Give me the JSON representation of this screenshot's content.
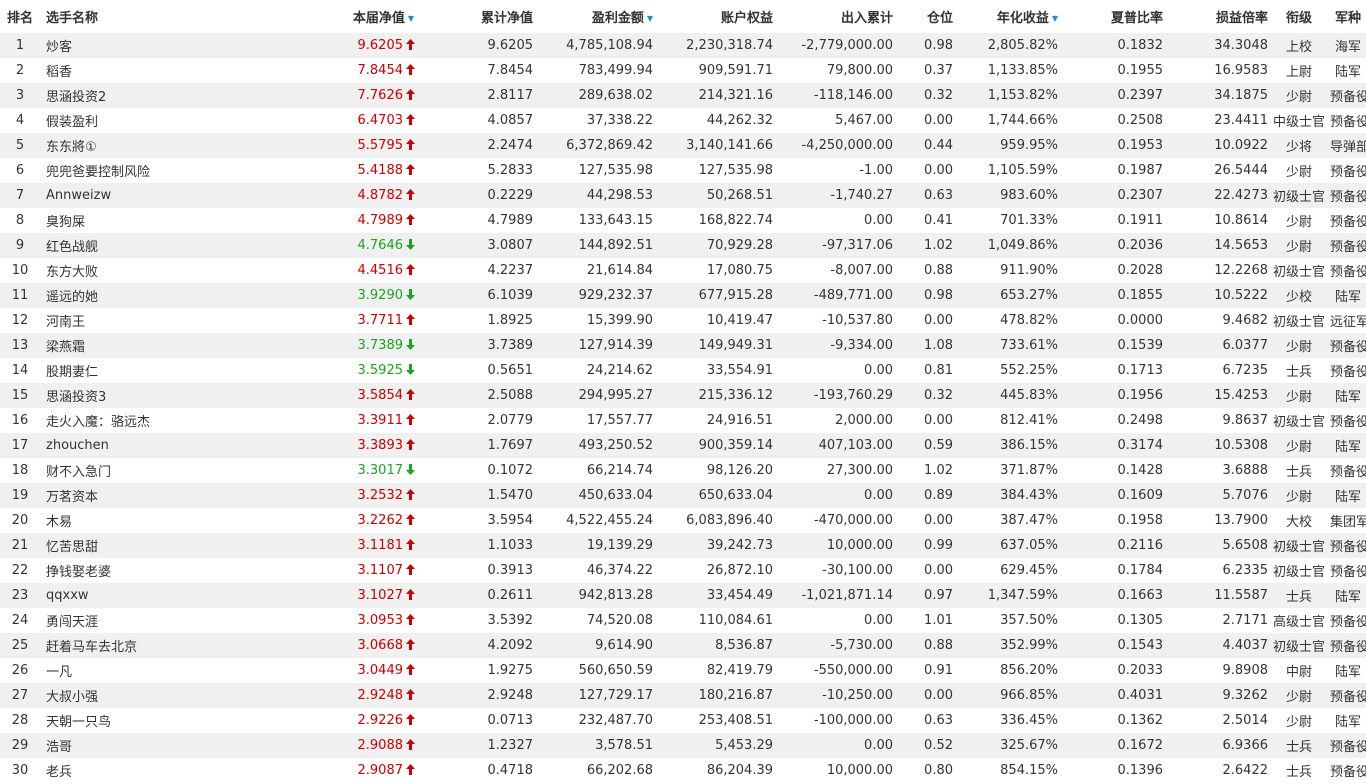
{
  "columns": [
    "排名",
    "选手名称",
    "本届净值",
    "累计净值",
    "盈利金额",
    "账户权益",
    "出入累计",
    "仓位",
    "年化收益",
    "夏普比率",
    "损益倍率",
    "衔级",
    "军种"
  ],
  "colors": {
    "up": "#cc0000",
    "down": "#1aa51a",
    "sort": "#1a8fd8",
    "stripe": "#f0f0f0"
  },
  "rows": [
    {
      "rank": "1",
      "name": "炒客",
      "nav": "9.6205",
      "dir": "up",
      "cum": "9.6205",
      "profit": "4,785,108.94",
      "equity": "2,230,318.74",
      "flow": "-2,779,000.00",
      "pos": "0.98",
      "annual": "2,805.82%",
      "sharpe": "0.1832",
      "pl": "34.3048",
      "grade": "上校",
      "branch": "海军"
    },
    {
      "rank": "2",
      "name": "稻香",
      "nav": "7.8454",
      "dir": "up",
      "cum": "7.8454",
      "profit": "783,499.94",
      "equity": "909,591.71",
      "flow": "79,800.00",
      "pos": "0.37",
      "annual": "1,133.85%",
      "sharpe": "0.1955",
      "pl": "16.9583",
      "grade": "上尉",
      "branch": "陆军"
    },
    {
      "rank": "3",
      "name": "思涵投资2",
      "nav": "7.7626",
      "dir": "up",
      "cum": "2.8117",
      "profit": "289,638.02",
      "equity": "214,321.16",
      "flow": "-118,146.00",
      "pos": "0.32",
      "annual": "1,153.82%",
      "sharpe": "0.2397",
      "pl": "34.1875",
      "grade": "少尉",
      "branch": "预备役"
    },
    {
      "rank": "4",
      "name": "假装盈利",
      "nav": "6.4703",
      "dir": "up",
      "cum": "4.0857",
      "profit": "37,338.22",
      "equity": "44,262.32",
      "flow": "5,467.00",
      "pos": "0.00",
      "annual": "1,744.66%",
      "sharpe": "0.2508",
      "pl": "23.4411",
      "grade": "中级士官",
      "branch": "预备役"
    },
    {
      "rank": "5",
      "name": "东东將①",
      "nav": "5.5795",
      "dir": "up",
      "cum": "2.2474",
      "profit": "6,372,869.42",
      "equity": "3,140,141.66",
      "flow": "-4,250,000.00",
      "pos": "0.44",
      "annual": "959.95%",
      "sharpe": "0.1953",
      "pl": "10.0922",
      "grade": "少将",
      "branch": "导弹部队"
    },
    {
      "rank": "6",
      "name": "兜兜爸要控制风险",
      "nav": "5.4188",
      "dir": "up",
      "cum": "5.2833",
      "profit": "127,535.98",
      "equity": "127,535.98",
      "flow": "-1.00",
      "pos": "0.00",
      "annual": "1,105.59%",
      "sharpe": "0.1987",
      "pl": "26.5444",
      "grade": "少尉",
      "branch": "预备役"
    },
    {
      "rank": "7",
      "name": "Annweizw",
      "nav": "4.8782",
      "dir": "up",
      "cum": "0.2229",
      "profit": "44,298.53",
      "equity": "50,268.51",
      "flow": "-1,740.27",
      "pos": "0.63",
      "annual": "983.60%",
      "sharpe": "0.2307",
      "pl": "22.4273",
      "grade": "初级士官",
      "branch": "预备役"
    },
    {
      "rank": "8",
      "name": "臭狗屎",
      "nav": "4.7989",
      "dir": "up",
      "cum": "4.7989",
      "profit": "133,643.15",
      "equity": "168,822.74",
      "flow": "0.00",
      "pos": "0.41",
      "annual": "701.33%",
      "sharpe": "0.1911",
      "pl": "10.8614",
      "grade": "少尉",
      "branch": "预备役"
    },
    {
      "rank": "9",
      "name": "红色战舰",
      "nav": "4.7646",
      "dir": "down",
      "cum": "3.0807",
      "profit": "144,892.51",
      "equity": "70,929.28",
      "flow": "-97,317.06",
      "pos": "1.02",
      "annual": "1,049.86%",
      "sharpe": "0.2036",
      "pl": "14.5653",
      "grade": "少尉",
      "branch": "预备役"
    },
    {
      "rank": "10",
      "name": "东方大败",
      "nav": "4.4516",
      "dir": "up",
      "cum": "4.2237",
      "profit": "21,614.84",
      "equity": "17,080.75",
      "flow": "-8,007.00",
      "pos": "0.88",
      "annual": "911.90%",
      "sharpe": "0.2028",
      "pl": "12.2268",
      "grade": "初级士官",
      "branch": "预备役"
    },
    {
      "rank": "11",
      "name": "遥远的她",
      "nav": "3.9290",
      "dir": "down",
      "cum": "6.1039",
      "profit": "929,232.37",
      "equity": "677,915.28",
      "flow": "-489,771.00",
      "pos": "0.98",
      "annual": "653.27%",
      "sharpe": "0.1855",
      "pl": "10.5222",
      "grade": "少校",
      "branch": "陆军"
    },
    {
      "rank": "12",
      "name": "河南王",
      "nav": "3.7711",
      "dir": "up",
      "cum": "1.8925",
      "profit": "15,399.90",
      "equity": "10,419.47",
      "flow": "-10,537.80",
      "pos": "0.00",
      "annual": "478.82%",
      "sharpe": "0.0000",
      "pl": "9.4682",
      "grade": "初级士官",
      "branch": "远征军"
    },
    {
      "rank": "13",
      "name": "梁燕霜",
      "nav": "3.7389",
      "dir": "down",
      "cum": "3.7389",
      "profit": "127,914.39",
      "equity": "149,949.31",
      "flow": "-9,334.00",
      "pos": "1.08",
      "annual": "733.61%",
      "sharpe": "0.1539",
      "pl": "6.0377",
      "grade": "少尉",
      "branch": "预备役"
    },
    {
      "rank": "14",
      "name": "股期妻仁",
      "nav": "3.5925",
      "dir": "down",
      "cum": "0.5651",
      "profit": "24,214.62",
      "equity": "33,554.91",
      "flow": "0.00",
      "pos": "0.81",
      "annual": "552.25%",
      "sharpe": "0.1713",
      "pl": "6.7235",
      "grade": "士兵",
      "branch": "预备役"
    },
    {
      "rank": "15",
      "name": "思涵投资3",
      "nav": "3.5854",
      "dir": "up",
      "cum": "2.5088",
      "profit": "294,995.27",
      "equity": "215,336.12",
      "flow": "-193,760.29",
      "pos": "0.32",
      "annual": "445.83%",
      "sharpe": "0.1956",
      "pl": "15.4253",
      "grade": "少尉",
      "branch": "陆军"
    },
    {
      "rank": "16",
      "name": "走火入魔：骆远杰",
      "nav": "3.3911",
      "dir": "up",
      "cum": "2.0779",
      "profit": "17,557.77",
      "equity": "24,916.51",
      "flow": "2,000.00",
      "pos": "0.00",
      "annual": "812.41%",
      "sharpe": "0.2498",
      "pl": "9.8637",
      "grade": "初级士官",
      "branch": "预备役"
    },
    {
      "rank": "17",
      "name": "zhouchen",
      "nav": "3.3893",
      "dir": "up",
      "cum": "1.7697",
      "profit": "493,250.52",
      "equity": "900,359.14",
      "flow": "407,103.00",
      "pos": "0.59",
      "annual": "386.15%",
      "sharpe": "0.3174",
      "pl": "10.5308",
      "grade": "少尉",
      "branch": "陆军"
    },
    {
      "rank": "18",
      "name": "财不入急门",
      "nav": "3.3017",
      "dir": "down",
      "cum": "0.1072",
      "profit": "66,214.74",
      "equity": "98,126.20",
      "flow": "27,300.00",
      "pos": "1.02",
      "annual": "371.87%",
      "sharpe": "0.1428",
      "pl": "3.6888",
      "grade": "士兵",
      "branch": "预备役"
    },
    {
      "rank": "19",
      "name": "万茗资本",
      "nav": "3.2532",
      "dir": "up",
      "cum": "1.5470",
      "profit": "450,633.04",
      "equity": "650,633.04",
      "flow": "0.00",
      "pos": "0.89",
      "annual": "384.43%",
      "sharpe": "0.1609",
      "pl": "5.7076",
      "grade": "少尉",
      "branch": "陆军"
    },
    {
      "rank": "20",
      "name": "木易",
      "nav": "3.2262",
      "dir": "up",
      "cum": "3.5954",
      "profit": "4,522,455.24",
      "equity": "6,083,896.40",
      "flow": "-470,000.00",
      "pos": "0.00",
      "annual": "387.47%",
      "sharpe": "0.1958",
      "pl": "13.7900",
      "grade": "大校",
      "branch": "集团军"
    },
    {
      "rank": "21",
      "name": "忆苦思甜",
      "nav": "3.1181",
      "dir": "up",
      "cum": "1.1033",
      "profit": "19,139.29",
      "equity": "39,242.73",
      "flow": "10,000.00",
      "pos": "0.99",
      "annual": "637.05%",
      "sharpe": "0.2116",
      "pl": "5.6508",
      "grade": "初级士官",
      "branch": "预备役"
    },
    {
      "rank": "22",
      "name": "挣钱娶老婆",
      "nav": "3.1107",
      "dir": "up",
      "cum": "0.3913",
      "profit": "46,374.22",
      "equity": "26,872.10",
      "flow": "-30,100.00",
      "pos": "0.00",
      "annual": "629.45%",
      "sharpe": "0.1784",
      "pl": "6.2335",
      "grade": "初级士官",
      "branch": "预备役"
    },
    {
      "rank": "23",
      "name": "qqxxw",
      "nav": "3.1027",
      "dir": "up",
      "cum": "0.2611",
      "profit": "942,813.28",
      "equity": "33,454.49",
      "flow": "-1,021,871.14",
      "pos": "0.97",
      "annual": "1,347.59%",
      "sharpe": "0.1663",
      "pl": "11.5587",
      "grade": "士兵",
      "branch": "陆军"
    },
    {
      "rank": "24",
      "name": "勇闯天涯",
      "nav": "3.0953",
      "dir": "up",
      "cum": "3.5392",
      "profit": "74,520.08",
      "equity": "110,084.61",
      "flow": "0.00",
      "pos": "1.01",
      "annual": "357.50%",
      "sharpe": "0.1305",
      "pl": "2.7171",
      "grade": "高级士官",
      "branch": "预备役"
    },
    {
      "rank": "25",
      "name": "赶着马车去北京",
      "nav": "3.0668",
      "dir": "up",
      "cum": "4.2092",
      "profit": "9,614.90",
      "equity": "8,536.87",
      "flow": "-5,730.00",
      "pos": "0.88",
      "annual": "352.99%",
      "sharpe": "0.1543",
      "pl": "4.4037",
      "grade": "初级士官",
      "branch": "预备役"
    },
    {
      "rank": "26",
      "name": "一凡",
      "nav": "3.0449",
      "dir": "up",
      "cum": "1.9275",
      "profit": "560,650.59",
      "equity": "82,419.79",
      "flow": "-550,000.00",
      "pos": "0.91",
      "annual": "856.20%",
      "sharpe": "0.2033",
      "pl": "9.8908",
      "grade": "中尉",
      "branch": "陆军"
    },
    {
      "rank": "27",
      "name": "大叔小强",
      "nav": "2.9248",
      "dir": "up",
      "cum": "2.9248",
      "profit": "127,729.17",
      "equity": "180,216.87",
      "flow": "-10,250.00",
      "pos": "0.00",
      "annual": "966.85%",
      "sharpe": "0.4031",
      "pl": "9.3262",
      "grade": "少尉",
      "branch": "预备役"
    },
    {
      "rank": "28",
      "name": "天朝一只鸟",
      "nav": "2.9226",
      "dir": "up",
      "cum": "0.0713",
      "profit": "232,487.70",
      "equity": "253,408.51",
      "flow": "-100,000.00",
      "pos": "0.63",
      "annual": "336.45%",
      "sharpe": "0.1362",
      "pl": "2.5014",
      "grade": "少尉",
      "branch": "陆军"
    },
    {
      "rank": "29",
      "name": "浩哥",
      "nav": "2.9088",
      "dir": "up",
      "cum": "1.2327",
      "profit": "3,578.51",
      "equity": "5,453.29",
      "flow": "0.00",
      "pos": "0.52",
      "annual": "325.67%",
      "sharpe": "0.1672",
      "pl": "6.9366",
      "grade": "士兵",
      "branch": "预备役"
    },
    {
      "rank": "30",
      "name": "老兵",
      "nav": "2.9087",
      "dir": "up",
      "cum": "0.4718",
      "profit": "66,202.68",
      "equity": "86,204.39",
      "flow": "10,000.00",
      "pos": "0.80",
      "annual": "854.15%",
      "sharpe": "0.1396",
      "pl": "2.6422",
      "grade": "士兵",
      "branch": "预备役"
    }
  ]
}
